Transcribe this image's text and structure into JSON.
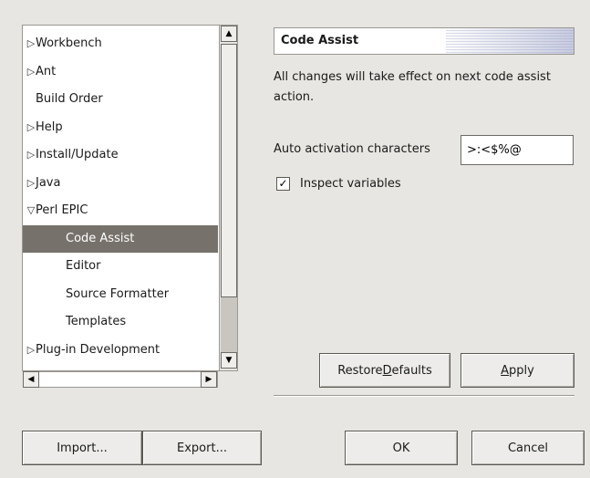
{
  "tree": {
    "items": [
      {
        "label": "Workbench",
        "level": 0,
        "toggle": "collapsed"
      },
      {
        "label": "Ant",
        "level": 0,
        "toggle": "collapsed"
      },
      {
        "label": "Build Order",
        "level": 0,
        "toggle": "none"
      },
      {
        "label": "Help",
        "level": 0,
        "toggle": "collapsed"
      },
      {
        "label": "Install/Update",
        "level": 0,
        "toggle": "collapsed"
      },
      {
        "label": "Java",
        "level": 0,
        "toggle": "collapsed"
      },
      {
        "label": "Perl EPIC",
        "level": 0,
        "toggle": "expanded"
      },
      {
        "label": "Code Assist",
        "level": 1,
        "toggle": "none",
        "selected": true
      },
      {
        "label": "Editor",
        "level": 1,
        "toggle": "none"
      },
      {
        "label": "Source Formatter",
        "level": 1,
        "toggle": "none"
      },
      {
        "label": "Templates",
        "level": 1,
        "toggle": "none"
      },
      {
        "label": "Plug-in Development",
        "level": 0,
        "toggle": "collapsed"
      }
    ],
    "toggle_glyphs": {
      "collapsed": "▷",
      "expanded": "▽",
      "none": ""
    }
  },
  "scrollbar": {
    "up_arrow": "▲",
    "down_arrow": "▼",
    "left_arrow": "◀",
    "right_arrow": "▶"
  },
  "page": {
    "title": "Code Assist",
    "description": "All changes will take effect on next code assist action.",
    "auto_activation_label": "Auto activation characters",
    "auto_activation_value": ">:<$%@",
    "inspect_variables_label": "Inspect variables",
    "inspect_variables_checked": true,
    "check_glyph": "✓"
  },
  "buttons": {
    "restore_defaults_pre": "Restore ",
    "restore_defaults_key": "D",
    "restore_defaults_post": "efaults",
    "apply_key": "A",
    "apply_post": "pply",
    "import": "Import...",
    "export": "Export...",
    "ok": "OK",
    "cancel": "Cancel"
  },
  "colors": {
    "selection": "#76726b",
    "background": "#e8e6e2"
  }
}
